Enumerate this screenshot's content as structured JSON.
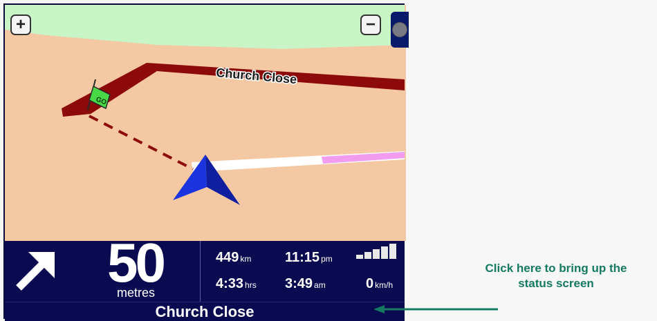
{
  "map": {
    "street_label": "Church Close",
    "flag_label": "GO",
    "zoom_in_symbol": "+",
    "zoom_out_symbol": "−",
    "colors": {
      "ground": "#f4c8a2",
      "park": "#c8f4c6",
      "route": "#8c0a0a",
      "road": "#ffffff",
      "highlight": "#f29cf0",
      "position_arrow": "#1a2fd0"
    }
  },
  "instruction": {
    "turn_icon": "arrow-up-right-icon",
    "distance": "50",
    "distance_unit": "metres"
  },
  "status": {
    "distance_remaining": "449",
    "distance_remaining_unit": "km",
    "arrival_time": "11:15",
    "arrival_time_unit": "pm",
    "time_remaining": "4:33",
    "time_remaining_unit": "hrs",
    "current_time": "3:49",
    "current_time_unit": "am",
    "speed": "0",
    "speed_unit": "km/h",
    "signal_strength_bars": 5
  },
  "street_bar": {
    "name": "Church Close"
  },
  "callout": {
    "line1": "Click here to bring up the",
    "line2": "status screen",
    "color": "#147a62"
  }
}
